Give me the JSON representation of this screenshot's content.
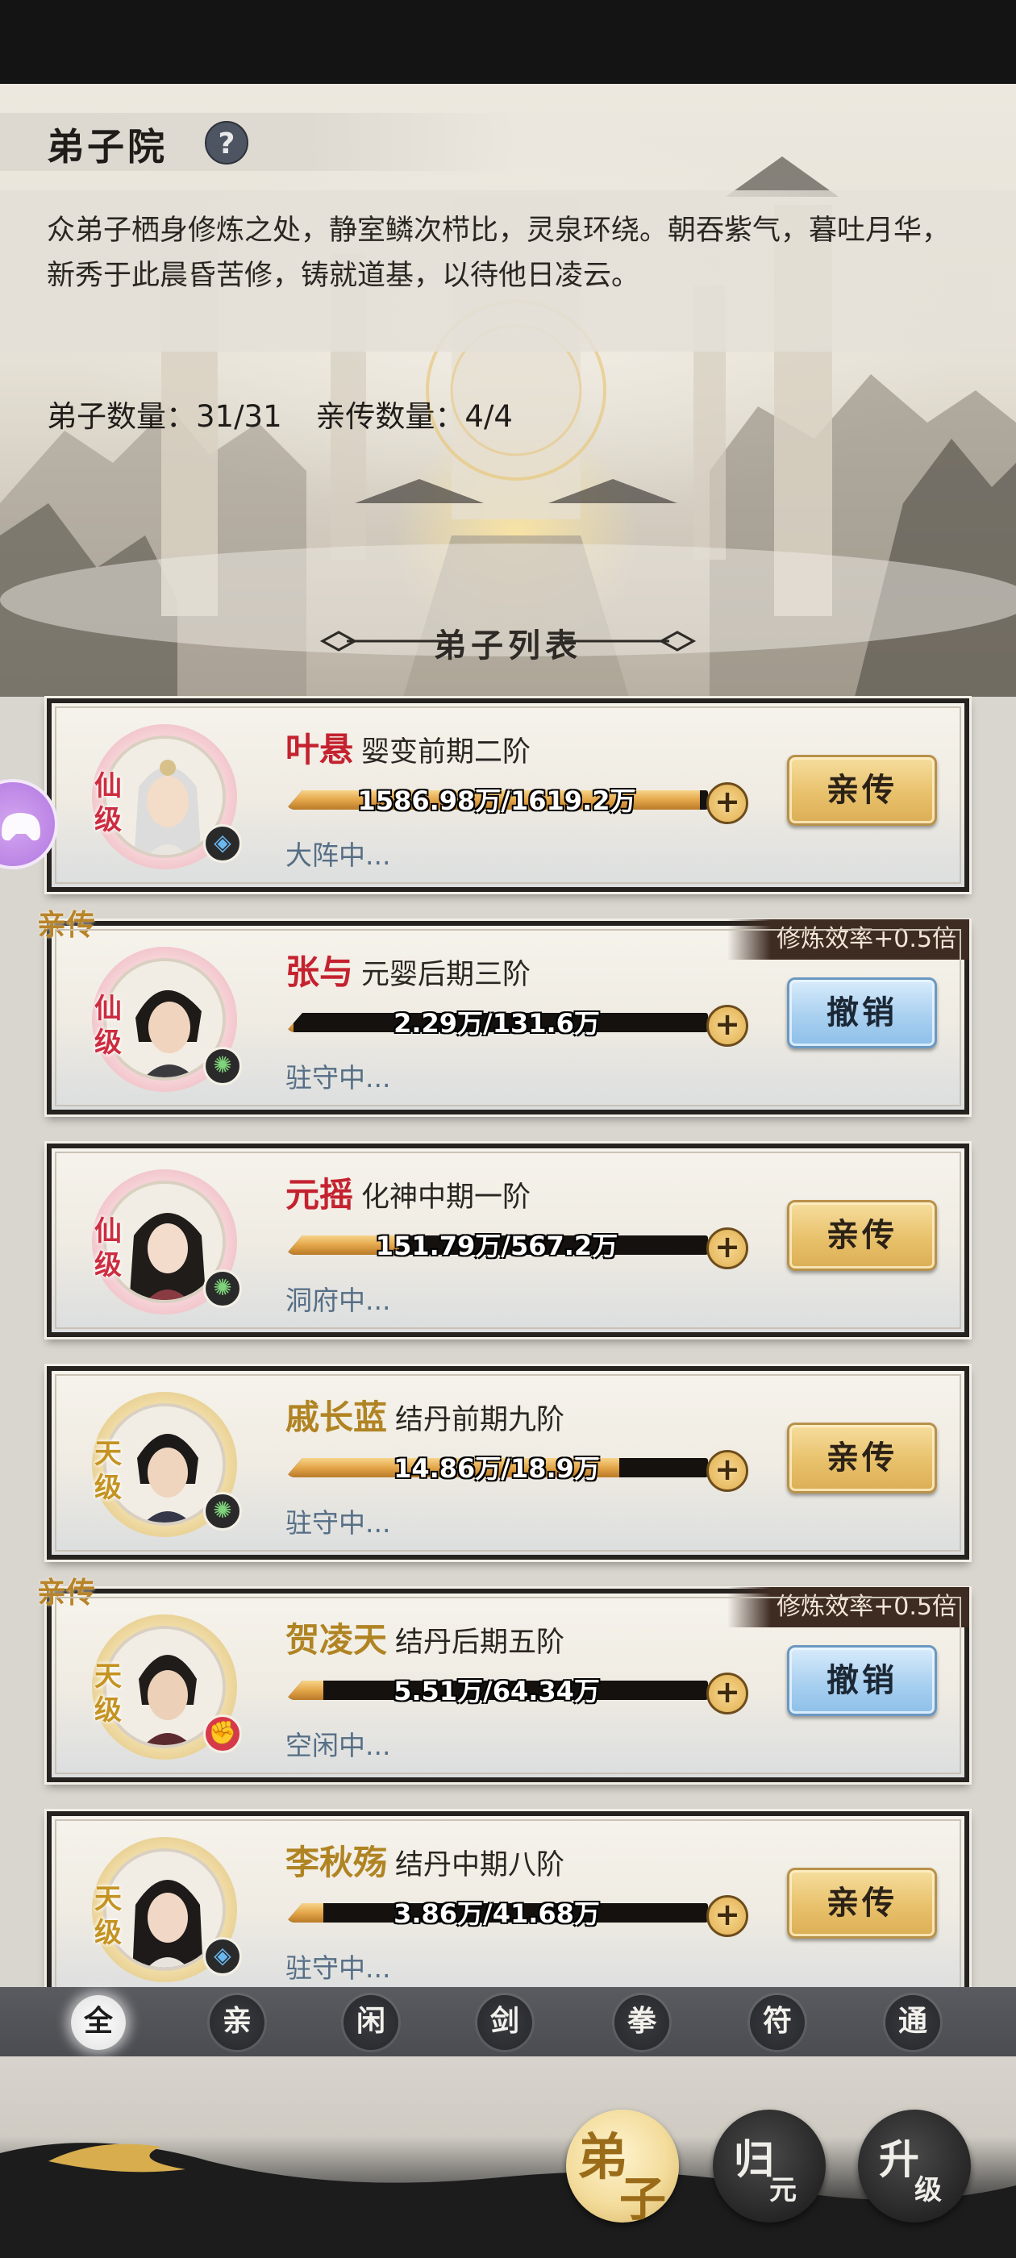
{
  "header": {
    "title": "弟子院",
    "help_label": "?",
    "description": "众弟子栖身修炼之处，静室鳞次栉比，灵泉环绕。朝吞紫气，暮吐月华，新秀于此晨昏苦修，铸就道基，以待他日凌云。",
    "disciple_count": "弟子数量：31/31",
    "core_count": "亲传数量：4/4",
    "section_title": "弟子列表"
  },
  "disciples": [
    {
      "name": "叶悬",
      "realm": "婴变前期二阶",
      "progress_text": "1586.98万/1619.2万",
      "progress": 0.98,
      "status": "大阵中...",
      "grade": "仙级",
      "action": "亲传",
      "core": false,
      "element": "blue"
    },
    {
      "name": "张与",
      "realm": "元婴后期三阶",
      "progress_text": "2.29万/131.6万",
      "progress": 0.02,
      "status": "驻守中...",
      "grade": "仙级",
      "action": "撤销",
      "core": true,
      "tag": "亲传",
      "bonus": "修炼效率+0.5倍",
      "element": "green"
    },
    {
      "name": "元摇",
      "realm": "化神中期一阶",
      "progress_text": "151.79万/567.2万",
      "progress": 0.27,
      "status": "洞府中...",
      "grade": "仙级",
      "action": "亲传",
      "core": false,
      "element": "green"
    },
    {
      "name": "戚长蓝",
      "realm": "结丹前期九阶",
      "progress_text": "14.86万/18.9万",
      "progress": 0.79,
      "status": "驻守中...",
      "grade": "天级",
      "action": "亲传",
      "core": false,
      "element": "green"
    },
    {
      "name": "贺凌天",
      "realm": "结丹后期五阶",
      "progress_text": "5.51万/64.34万",
      "progress": 0.09,
      "status": "空闲中...",
      "grade": "天级",
      "action": "撤销",
      "core": true,
      "tag": "亲传",
      "bonus": "修炼效率+0.5倍",
      "element": "red"
    },
    {
      "name": "李秋殇",
      "realm": "结丹中期八阶",
      "progress_text": "3.86万/41.68万",
      "progress": 0.09,
      "status": "驻守中...",
      "grade": "天级",
      "action": "亲传",
      "core": false,
      "element": "blue"
    }
  ],
  "filters": [
    "全",
    "亲",
    "闲",
    "剑",
    "拳",
    "符",
    "通"
  ],
  "nav": [
    {
      "c1": "弟",
      "c2": "子",
      "active": true
    },
    {
      "c1": "归",
      "c2": "元",
      "active": false
    },
    {
      "c1": "升",
      "c2": "级",
      "active": false
    }
  ],
  "plus_label": "+",
  "colors": {
    "immortal": "#c4222f",
    "heaven": "#b08423",
    "gold_button": "#e8c16b",
    "revoke_button": "#a9d0f0"
  }
}
